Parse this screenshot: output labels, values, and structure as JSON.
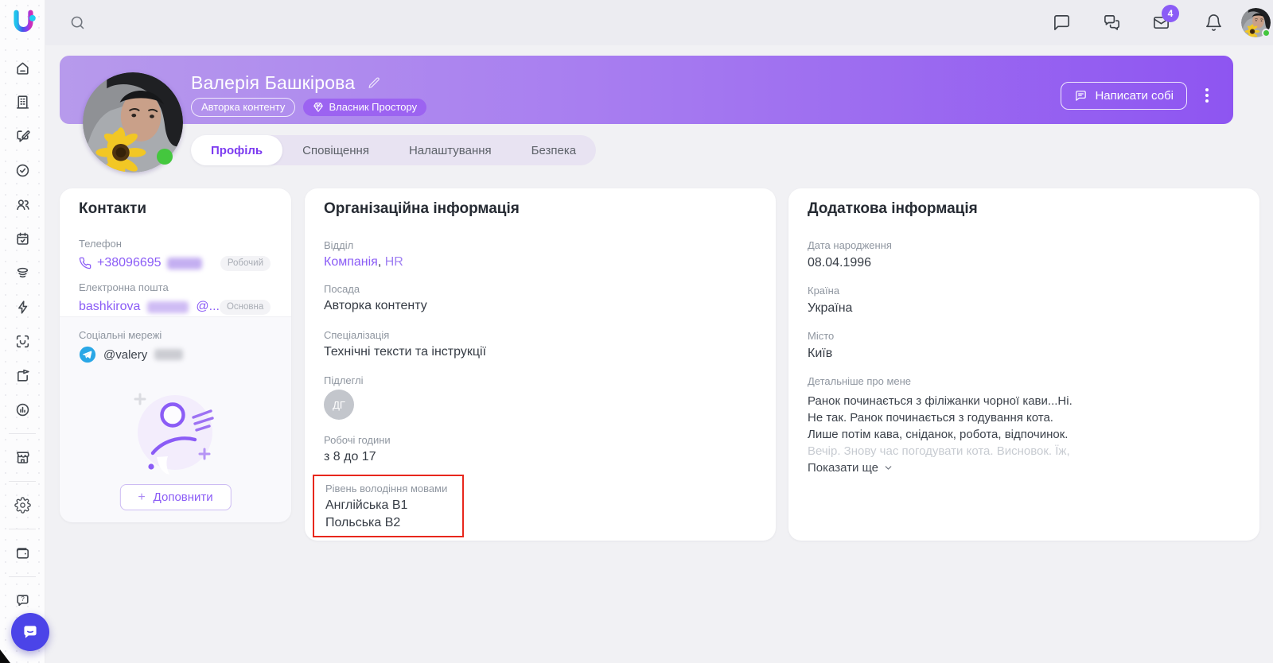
{
  "brand": {
    "logo_letter": "U"
  },
  "topbar": {
    "mail_badge": "4"
  },
  "icons": {
    "search": "magnifier",
    "chat": "speech-bubble",
    "group_chat": "double-speech-bubble",
    "mail": "envelope",
    "notifications": "bell",
    "chevron_down": "⌄",
    "edit": "pencil",
    "owner_gem": "gem",
    "kebab": "⋮",
    "phone": "handset",
    "telegram": "paper-plane",
    "plus": "+",
    "messenger": "chat-smile"
  },
  "sidebar": {
    "icons": [
      "home",
      "company",
      "posts",
      "tasks",
      "people",
      "calendar",
      "layers",
      "automation",
      "face-id",
      "share",
      "analytics",
      "marketplace",
      "settings",
      "wallet",
      "help"
    ]
  },
  "header": {
    "name": "Валерія Башкірова",
    "badge_role": "Авторка контенту",
    "badge_owner": "Власник Простору",
    "write_self_label": "Написати собі"
  },
  "tabs": {
    "profile": "Профіль",
    "notifications": "Сповіщення",
    "settings": "Налаштування",
    "security": "Безпека"
  },
  "contacts": {
    "title": "Контакти",
    "phone_label": "Телефон",
    "phone_value": "+38096695",
    "phone_badge": "Робочий",
    "email_label": "Електронна пошта",
    "email_value": "bashkirova",
    "email_suffix": "@...",
    "email_badge": "Основна",
    "social_label": "Соціальні мережі",
    "social_value": "@valery",
    "add_plus": "+",
    "add_label": "Доповнити"
  },
  "org": {
    "title": "Організаційна інформація",
    "department_label": "Відділ",
    "department_link1": "Компанія",
    "department_comma": ", ",
    "department_link2": "HR",
    "position_label": "Посада",
    "position_value": "Авторка контенту",
    "specialization_label": "Спеціалізація",
    "specialization_value": "Технічні тексти та інструкції",
    "subordinates_label": "Підлеглі",
    "subordinate_initials": "ДГ",
    "hours_label": "Робочі години",
    "hours_value": "з 8 до 17",
    "languages_label": "Рівень володіння мовами",
    "language_1": "Англійська B1",
    "language_2": "Польська B2"
  },
  "extra": {
    "title": "Додаткова інформація",
    "birth_label": "Дата народження",
    "birth_value": "08.04.1996",
    "country_label": "Країна",
    "country_value": "Україна",
    "city_label": "Місто",
    "city_value": "Київ",
    "about_label": "Детальніше про мене",
    "about_line1": "Ранок починається з філіжанки чорної кави...Ні.",
    "about_line2": "Не так. Ранок починається з годування кота.",
    "about_line3": "Лише потім кава, сніданок, робота, відпочинок.",
    "about_line4": "Вечір. Знову час погодувати кота. Висновок. Їж,",
    "show_more_label": "Показати ще"
  },
  "annotation": {
    "purpose": "highlight-languages-block",
    "color": "#e8271c"
  },
  "colors": {
    "accent": "#8b5cf6",
    "banner_gradient_start": "#b79aec",
    "banner_gradient_end": "#8e55f1",
    "online_status": "#44c73e",
    "telegram": "#2aa7e6",
    "annotation_red": "#e8271c",
    "messenger_purple": "#4b44e8"
  }
}
